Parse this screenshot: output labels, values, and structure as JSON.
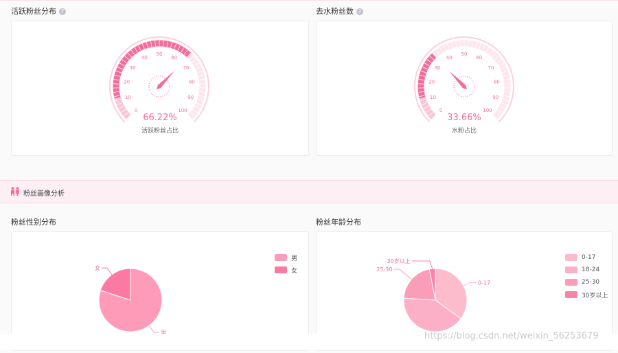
{
  "colors": {
    "accent": "#f56c9a",
    "gauge_track": "#fbd0de",
    "male": "#fd9bb9",
    "female": "#fb7aa3",
    "age_0_17": "#fdbccc",
    "age_18_24": "#fcb0c8",
    "age_25_30": "#fb9cb9",
    "age_30_plus": "#f884a8"
  },
  "active_fans": {
    "title": "活跃粉丝分布",
    "help_icon": "question-circle-icon",
    "value": 66.22,
    "value_text": "66.22%",
    "caption": "活跃粉丝占比",
    "ticks": [
      "0",
      "10",
      "20",
      "30",
      "40",
      "50",
      "60",
      "70",
      "80",
      "90",
      "100"
    ]
  },
  "dewatered_fans": {
    "title": "去水粉丝数",
    "help_icon": "question-circle-icon",
    "value": 33.66,
    "value_text": "33.66%",
    "caption": "水粉占比",
    "ticks": [
      "0",
      "10",
      "20",
      "30",
      "40",
      "50",
      "60",
      "70",
      "80",
      "90",
      "100"
    ]
  },
  "portrait_section": {
    "icon": "people-icon",
    "title": "粉丝画像分析"
  },
  "gender": {
    "title": "粉丝性别分布",
    "chart_data": {
      "type": "pie",
      "labels": [
        "男",
        "女"
      ],
      "values": [
        80,
        20
      ]
    },
    "legend": [
      "男",
      "女"
    ]
  },
  "age": {
    "title": "粉丝年龄分布",
    "chart_data": {
      "type": "pie",
      "labels": [
        "0-17",
        "18-24",
        "25-30",
        "30岁以上"
      ],
      "values": [
        35,
        41,
        21,
        3
      ]
    },
    "slice_labels": [
      "0-17",
      "25-30",
      "30岁以上"
    ],
    "legend": [
      "0-17",
      "18-24",
      "25-30",
      "30岁以上"
    ]
  },
  "watermark": "https://blog.csdn.net/weixin_56253679"
}
